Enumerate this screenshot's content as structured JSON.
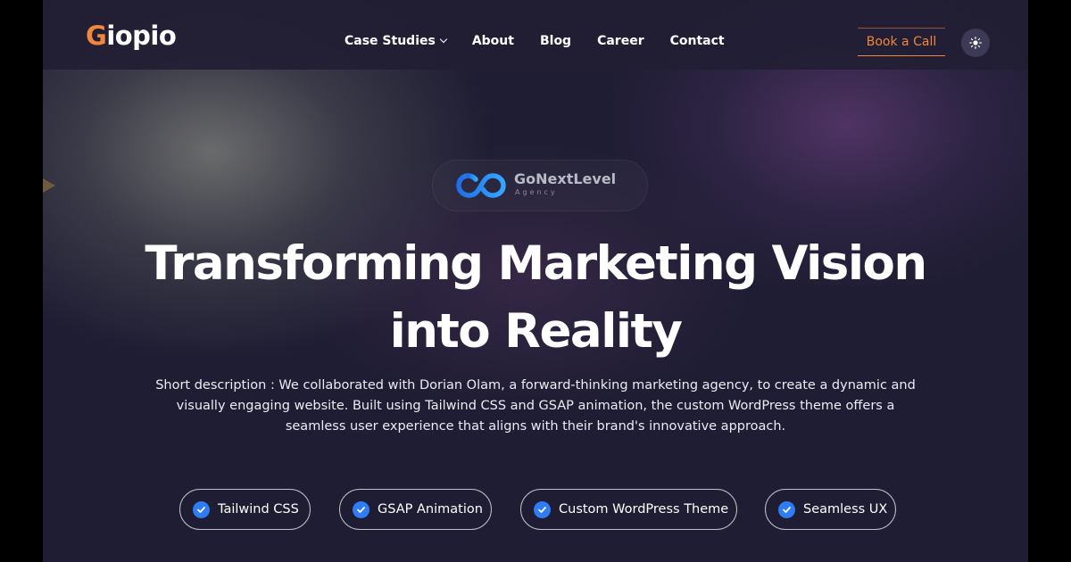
{
  "brand": {
    "logo_text_first": "G",
    "logo_text_rest": "iopio",
    "accent_color": "#f0873a"
  },
  "nav": {
    "items": [
      {
        "label": "Case Studies",
        "has_dropdown": true
      },
      {
        "label": "About"
      },
      {
        "label": "Blog"
      },
      {
        "label": "Career"
      },
      {
        "label": "Contact"
      }
    ],
    "cta_label": "Book a Call",
    "theme_toggle_icon": "sun-icon"
  },
  "client": {
    "name": "GoNextLevel",
    "subtitle": "Agency",
    "logo_color": "#2f7cf5"
  },
  "hero": {
    "title_line1": "Transforming Marketing Vision",
    "title_line2": "into Reality",
    "description_line1": "Short description : We collaborated with Dorian Olam, a forward-thinking marketing agency, to create a dynamic and",
    "description_line2": "visually engaging website. Built using Tailwind CSS and GSAP animation, the custom WordPress theme offers a",
    "description_line3": "seamless user experience that aligns with their brand's innovative approach."
  },
  "tags": [
    {
      "label": "Tailwind CSS",
      "icon": "check-circle-icon"
    },
    {
      "label": "GSAP Animation",
      "icon": "check-circle-icon"
    },
    {
      "label": "Custom WordPress Theme",
      "icon": "check-circle-icon"
    },
    {
      "label": "Seamless UX",
      "icon": "check-circle-icon"
    }
  ]
}
